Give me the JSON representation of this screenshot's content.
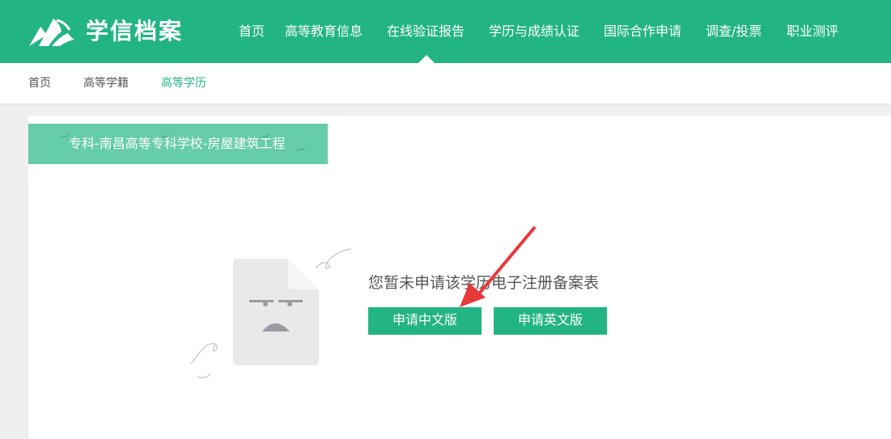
{
  "header": {
    "brand": "学信档案",
    "brand_color": "#23b484",
    "nav": [
      {
        "label": "首页"
      },
      {
        "label": "高等教育信息"
      },
      {
        "label": "在线验证报告"
      },
      {
        "label": "学历与成绩认证"
      },
      {
        "label": "国际合作申请"
      },
      {
        "label": "调查/投票"
      },
      {
        "label": "职业测评"
      }
    ]
  },
  "breadcrumb": {
    "items": [
      {
        "label": "首页"
      },
      {
        "label": "高等学籍"
      },
      {
        "label": "高等学历"
      }
    ]
  },
  "record": {
    "title": "专科-南昌高等专科学校-房屋建筑工程"
  },
  "empty_state": {
    "message": "您暂未申请该学历电子注册备案表",
    "apply_cn_label": "申请中文版",
    "apply_en_label": "申请英文版"
  },
  "annotation": {
    "arrow_color": "#e8393a"
  }
}
